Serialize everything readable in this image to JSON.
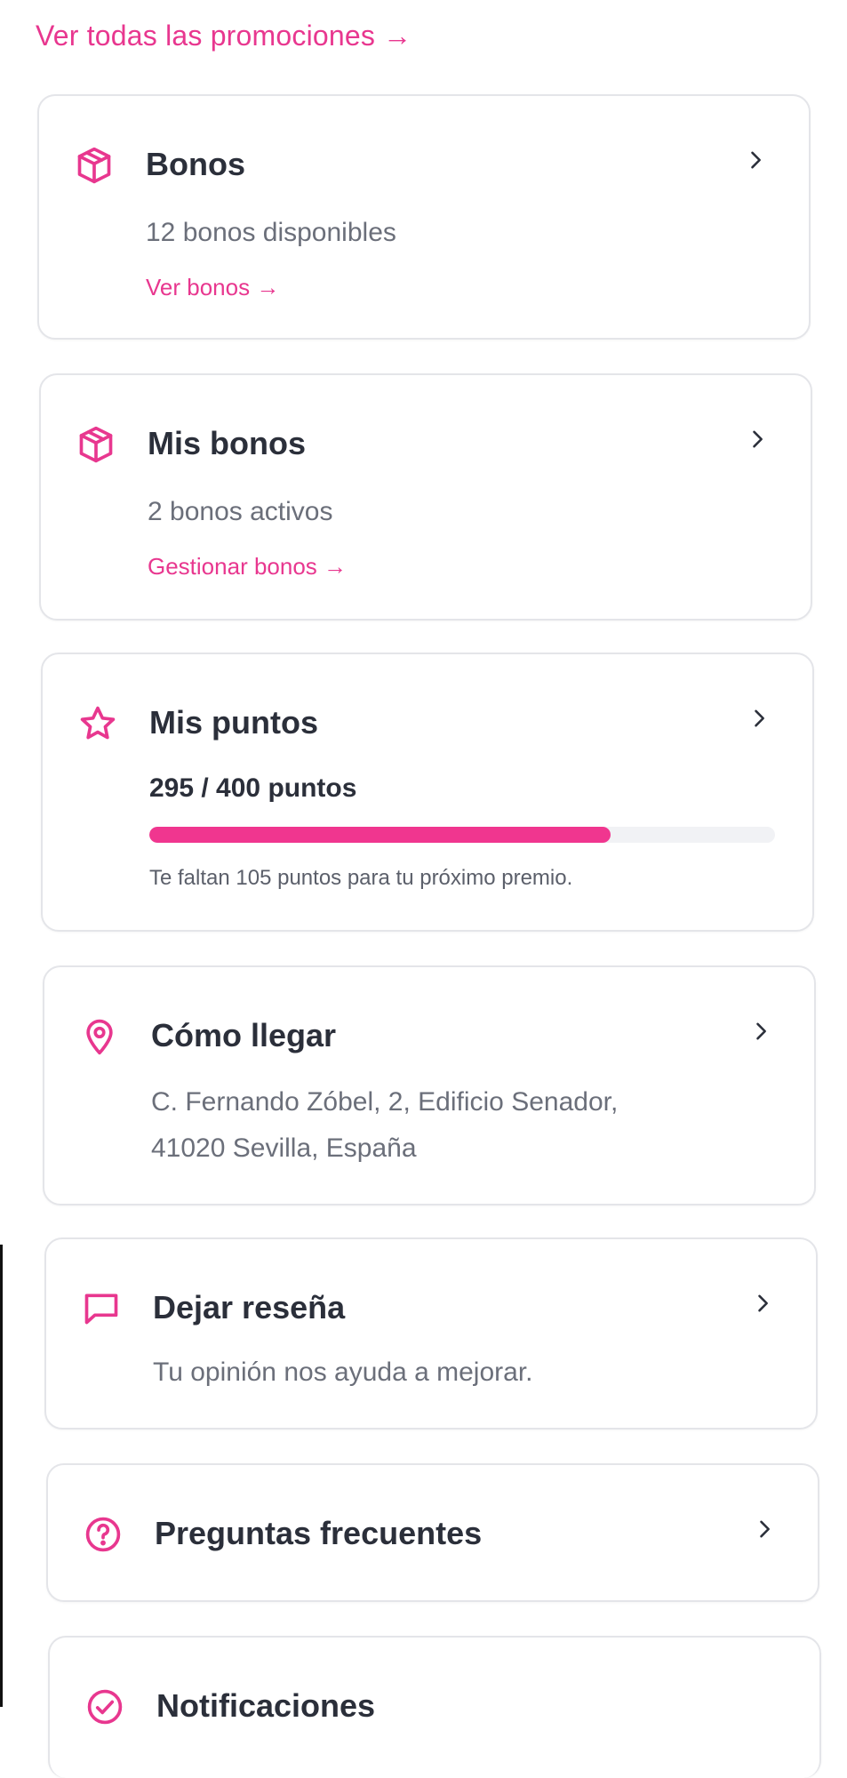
{
  "promotions_link": "Ver todas las promociones →",
  "cards": {
    "bonos": {
      "title": "Bonos",
      "subtitle": "12 bonos disponibles",
      "action": "Ver bonos →",
      "icon": "package-icon"
    },
    "mis_bonos": {
      "title": "Mis bonos",
      "subtitle": "2 bonos activos",
      "action": "Gestionar bonos →",
      "icon": "package-icon"
    },
    "mis_puntos": {
      "title": "Mis puntos",
      "points": "295 / 400 puntos",
      "progress_percent": 73.75,
      "note": "Te faltan 105 puntos para tu próximo premio.",
      "icon": "star-icon"
    },
    "como_llegar": {
      "title": "Cómo llegar",
      "address_line1": "C. Fernando Zóbel, 2, Edificio Senador,",
      "address_line2": "41020 Sevilla, España",
      "icon": "map-pin-icon"
    },
    "dejar_resena": {
      "title": "Dejar reseña",
      "subtitle": "Tu opinión nos ayuda a mejorar.",
      "icon": "message-square-icon"
    },
    "faq": {
      "title": "Preguntas frecuentes",
      "icon": "help-circle-icon"
    },
    "notificaciones": {
      "title": "Notificaciones",
      "icon": "check-circle-icon"
    }
  },
  "colors": {
    "accent": "#e8378f",
    "progress": "#f0368f",
    "track": "#f1f2f5",
    "text": "#2b2f3a",
    "muted": "#6b6f7a",
    "border": "#e4e5e9"
  }
}
